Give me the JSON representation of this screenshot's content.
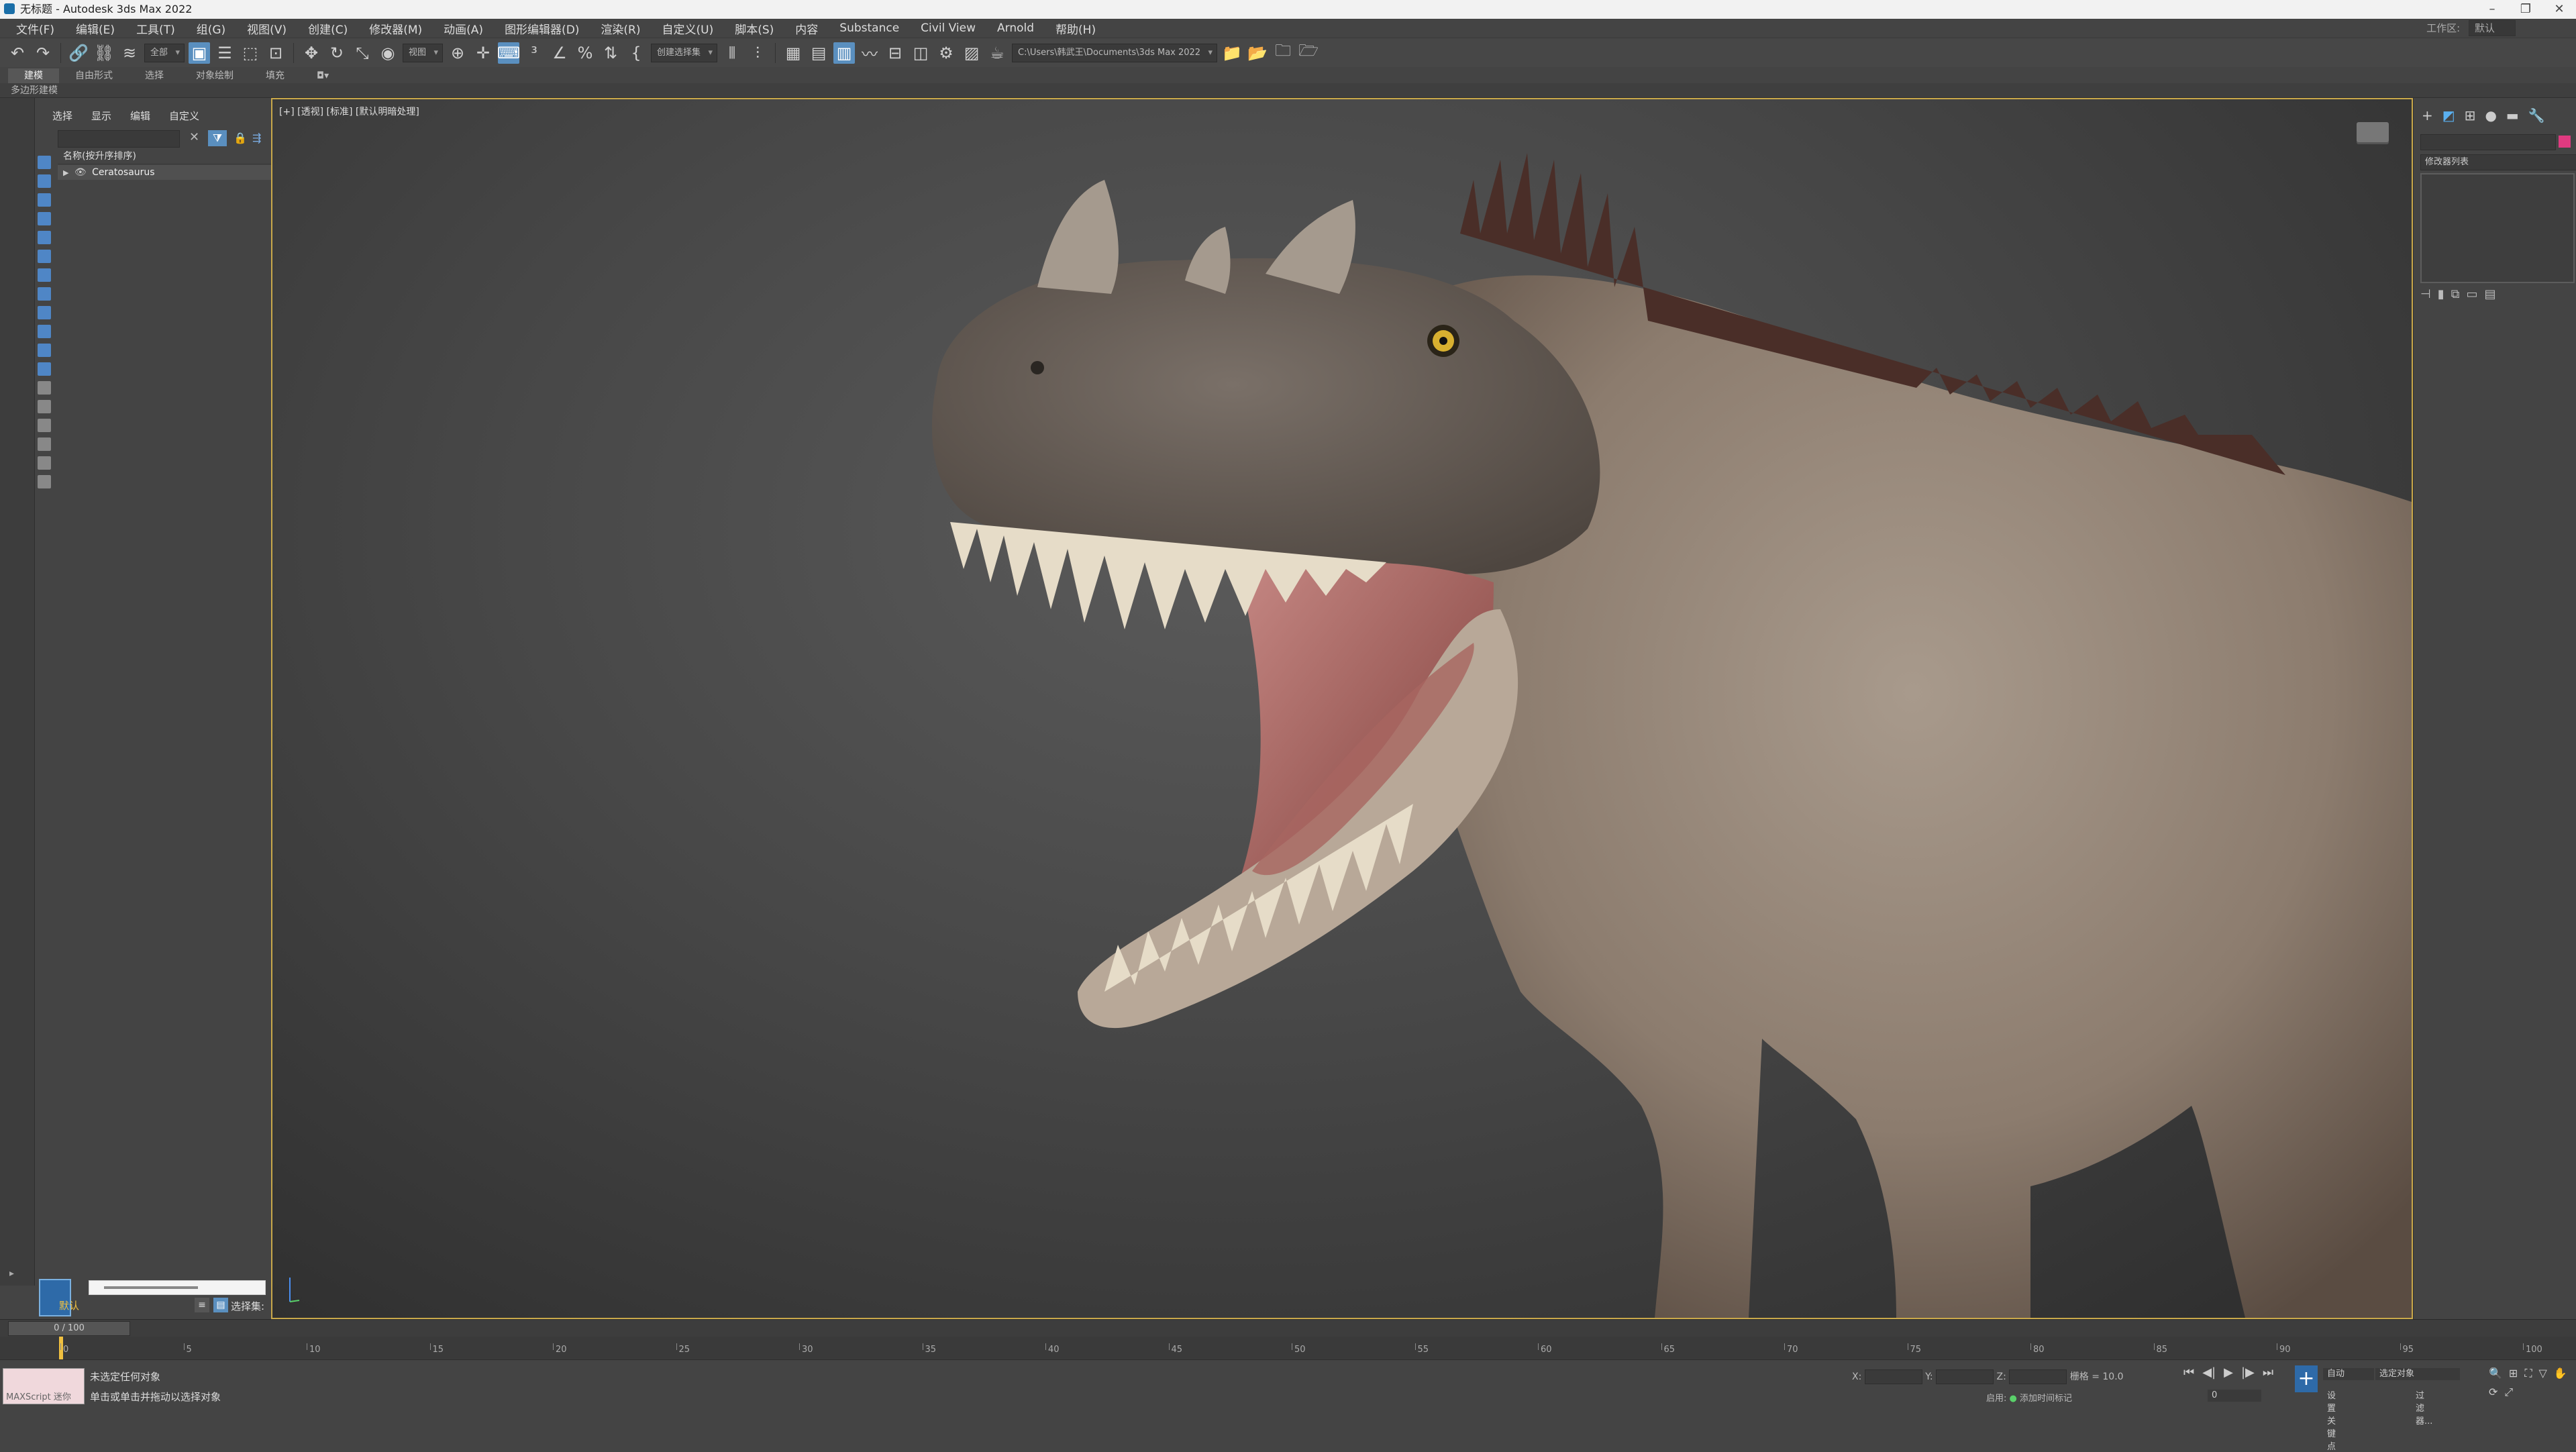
{
  "window": {
    "title": "无标题 - Autodesk 3ds Max 2022",
    "controls": [
      "–",
      "❐",
      "✕"
    ],
    "workspace_label": "工作区:",
    "workspace_value": "默认"
  },
  "menu": [
    "文件(F)",
    "编辑(E)",
    "工具(T)",
    "组(G)",
    "视图(V)",
    "创建(C)",
    "修改器(M)",
    "动画(A)",
    "图形编辑器(D)",
    "渲染(R)",
    "自定义(U)",
    "脚本(S)",
    "内容",
    "Substance",
    "Civil View",
    "Arnold",
    "帮助(H)"
  ],
  "toolbar": {
    "filter_dropdown": "全部",
    "coord_dropdown": "视图",
    "selection_set_dropdown": "创建选择集",
    "path_dropdown": "C:\\Users\\韩武王\\Documents\\3ds Max 2022"
  },
  "ribbon": {
    "tabs": [
      "建模",
      "自由形式",
      "选择",
      "对象绘制",
      "填充"
    ],
    "sub_label": "多边形建模"
  },
  "explorer": {
    "tabs": [
      "选择",
      "显示",
      "编辑",
      "自定义"
    ],
    "column_header": "名称(按升序排序)",
    "tree_item": "Ceratosaurus",
    "layer_name": "默认",
    "selection_set_label": "选择集:"
  },
  "viewport": {
    "label": "[+] [透视] [标准] [默认明暗处理]",
    "subject": "Ceratosaurus dinosaur model"
  },
  "command_panel": {
    "tabs": [
      "+",
      "modify",
      "hierarchy",
      "motion",
      "display",
      "utilities"
    ],
    "modifier_list": "修改器列表",
    "name_color": "#e03a80"
  },
  "timeline": {
    "frame_display": "0 / 100",
    "ticks": [
      0,
      5,
      10,
      15,
      20,
      25,
      30,
      35,
      40,
      45,
      50,
      55,
      60,
      65,
      70,
      75,
      80,
      85,
      90,
      95,
      100
    ]
  },
  "status": {
    "maxscript_label": "MAXScript 迷你",
    "line1": "未选定任何对象",
    "line2": "单击或单击并拖动以选择对象",
    "x_label": "X:",
    "y_label": "Y:",
    "z_label": "Z:",
    "grid": "栅格 = 10.0",
    "add_time_tag": "添加时间标记",
    "enabled": "启用:",
    "auto": "自动",
    "selected_object": "选定对象",
    "set_key": "设置关键点",
    "filters": "过滤器...",
    "frame_field": "0"
  }
}
